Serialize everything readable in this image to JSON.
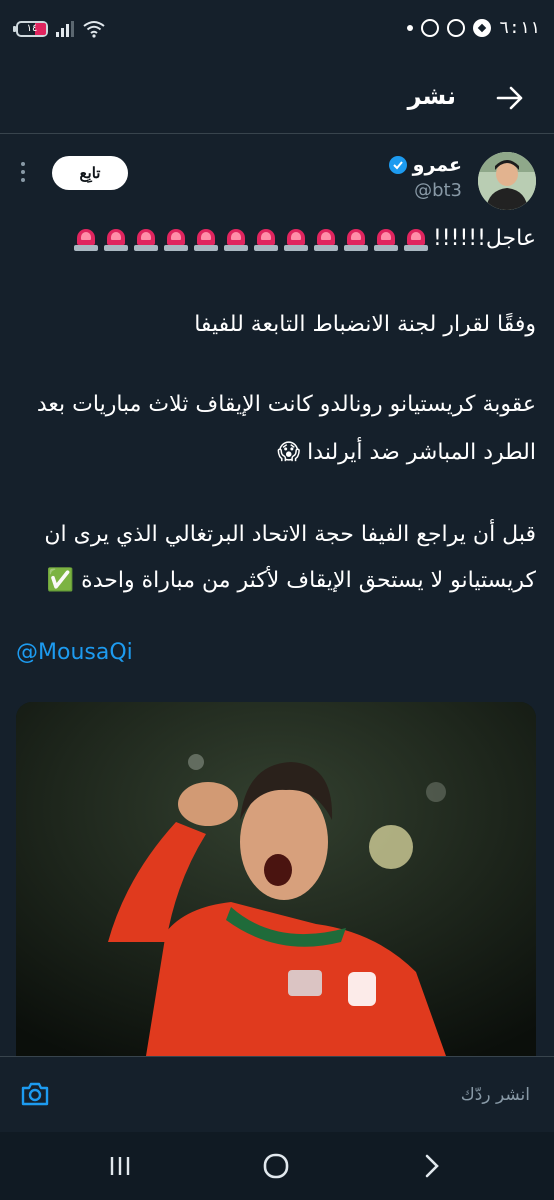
{
  "status": {
    "time": "٦:١١",
    "battery_text": "١٤"
  },
  "header": {
    "title": "نشر"
  },
  "tweet": {
    "author_name": "عمرو",
    "author_handle": "@bt3",
    "follow_label": "تابِع",
    "line1_text": "عاجل!!!!!!",
    "paragraph1": "وفقًا لقرار لجنة الانضباط التابعة للفيفا",
    "paragraph2a": "عقوبة كريستيانو رونالدو كانت الإيقاف ثلاث مباريات بعد",
    "paragraph2b": "الطرد المباشر ضد أيرلندا 😱",
    "paragraph3a": "قبل أن يراجع الفيفا حجة الاتحاد البرتغالي الذي يرى ان",
    "paragraph3b": "كريستيانو لا يستحق الإيقاف لأكثر من مباراة واحدة ✅",
    "mention": "@MousaQi"
  },
  "reply": {
    "placeholder": "انشر ردّك"
  },
  "icons": {
    "back": "arrow-right-icon",
    "camera": "camera-icon",
    "siren": "police-light-emoji",
    "verified": "verified-badge-icon"
  },
  "colors": {
    "background": "#15202b",
    "accent": "#1d9bf0",
    "siren": "#e0245e"
  }
}
